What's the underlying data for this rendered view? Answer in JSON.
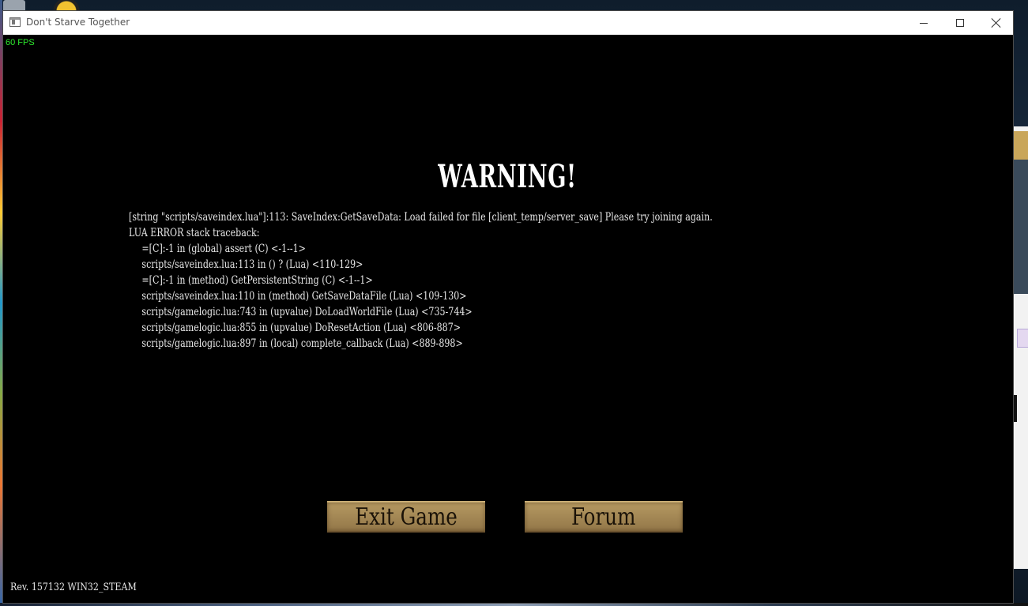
{
  "window": {
    "title": "Don't Starve Together"
  },
  "overlay": {
    "fps": "60 FPS"
  },
  "dialog": {
    "title": "WARNING!",
    "message": "[string \"scripts/saveindex.lua\"]:113: SaveIndex:GetSaveData: Load failed for file [client_temp/server_save] Please try joining again.",
    "traceback_header": "LUA ERROR stack traceback:",
    "traceback": [
      "=[C]:-1 in (global) assert (C) <-1--1>",
      "scripts/saveindex.lua:113 in () ? (Lua) <110-129>",
      "=[C]:-1 in (method) GetPersistentString (C) <-1--1>",
      "scripts/saveindex.lua:110 in (method) GetSaveDataFile (Lua) <109-130>",
      "scripts/gamelogic.lua:743 in (upvalue) DoLoadWorldFile (Lua) <735-744>",
      "scripts/gamelogic.lua:855 in (upvalue) DoResetAction (Lua) <806-887>",
      "scripts/gamelogic.lua:897 in (local) complete_callback (Lua) <889-898>"
    ],
    "buttons": {
      "exit": "Exit Game",
      "forum": "Forum"
    }
  },
  "footer": {
    "revision": "Rev. 157132 WIN32_STEAM"
  }
}
